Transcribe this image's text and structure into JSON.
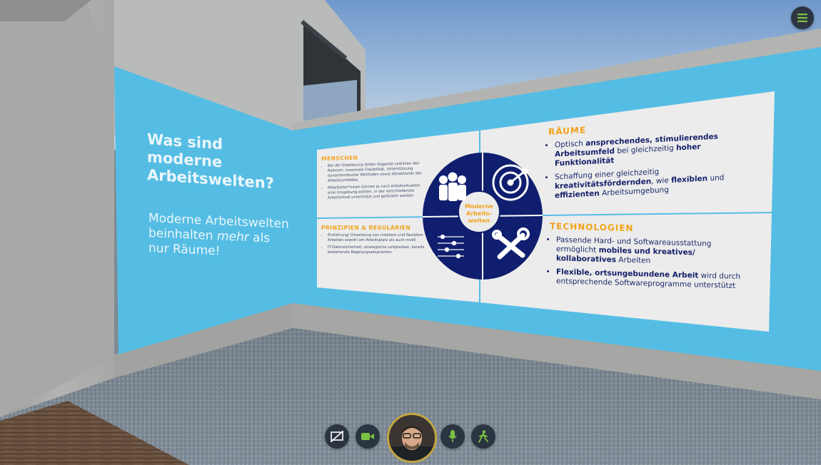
{
  "left_panel": {
    "heading_lines": [
      "Was sind",
      "moderne",
      "Arbeitswelten?"
    ],
    "sub_line1": "Moderne Arbeitswelten",
    "sub_line2a": "beinhalten ",
    "sub_line2_em": "mehr",
    "sub_line2b": " als",
    "sub_line3": "nur Räume!"
  },
  "board": {
    "center_label_lines": [
      "Moderne",
      "Arbeits-",
      "welten"
    ],
    "menschen": {
      "title": "MENSCHEN",
      "bullet1": "Bei der Etablierung bilden folgende Leitlinien den Rahmen: maximale Flexibilität, Unterstützung dynamikrobuster Methoden sowie Attraktivität des Arbeitsumfeldes",
      "bullet2": "Mitarbeiter*innen können je nach Arbeitssituation eine Umgebung wählen, in der verschiedenste Arbeitsmodi unterstützt und gefördert werden"
    },
    "prinzipien": {
      "title": "PRINZIPIEN & REGULARIEN",
      "bullet1": "Einführung/ Umsetzung von mobilem und flexiblem Arbeiten sowohl am Arbeitsplatz als auch mobil",
      "bullet2": "IT-Datensicherheit, strategische Leitplanken, bereits bestehende Regelungsabsprachen"
    },
    "raeume": {
      "title": "RÄUME",
      "b1_pre": "Optisch ",
      "b1_bold1": "ansprechendes, stimulierendes Arbeitsumfeld",
      "b1_mid": " bei gleichzeitig ",
      "b1_bold2": "hoher Funktionalität",
      "b2_pre": "Schaffung einer gleichzeitig ",
      "b2_bold1": "kreativitätsfördernden",
      "b2_mid": ", wie ",
      "b2_bold2": "flexiblen",
      "b2_and": " und ",
      "b2_bold3": "effizienten",
      "b2_post": " Arbeitsumgebung"
    },
    "technologien": {
      "title": "TECHNOLOGIEN",
      "b1_pre": "Passende Hard- und Softwareausstattung ermöglicht ",
      "b1_bold": "mobiles und kreatives/ kollaboratives",
      "b1_post": " Arbeiten",
      "b2_bold": "Flexible, ortsungebundene Arbeit",
      "b2_post": " wird durch entsprechende Softwareprogramme unterstützt"
    },
    "icons": [
      "people-icon",
      "radar-icon",
      "sliders-icon",
      "tools-icon"
    ]
  },
  "toolbar": {
    "buttons": [
      "screen-share-off-icon",
      "camera-icon",
      "microphone-icon",
      "walk-icon"
    ],
    "accent_color": "#7dc243",
    "avatar_border_color": "#c2a640"
  },
  "menu": {
    "icon": "hamburger-menu-icon",
    "color": "#7dc243"
  },
  "colors": {
    "board_blue": "#55bde4",
    "navy": "#0f1e6e",
    "yellow": "#f2a21a"
  }
}
